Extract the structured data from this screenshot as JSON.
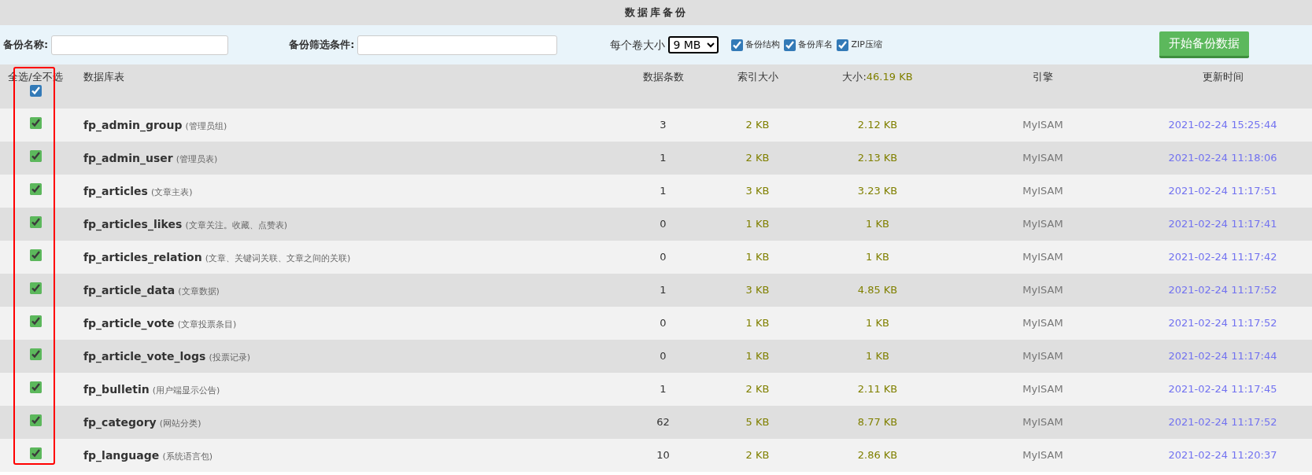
{
  "title": "数据库备份",
  "toolbar": {
    "name_label": "备份名称:",
    "filter_label": "备份筛选条件:",
    "volume_label": "每个卷大小",
    "volume_value": "9 MB",
    "options": [
      {
        "label": "备份结构",
        "checked": true
      },
      {
        "label": "备份库名",
        "checked": true
      },
      {
        "label": "ZIP压缩",
        "checked": true
      }
    ],
    "start_button": "开始备份数据"
  },
  "table": {
    "select_all": {
      "label": "全选/全不选",
      "checked": true
    },
    "columns": {
      "table": "数据库表",
      "rows": "数据条数",
      "index": "索引大小",
      "size_label": "大小:",
      "size_total": "46.19 KB",
      "engine": "引擎",
      "updated": "更新时间"
    },
    "rows": [
      {
        "checked": true,
        "name": "fp_admin_group",
        "comment": "(管理员组)",
        "rows": "3",
        "index": "2 KB",
        "size": "2.12 KB",
        "engine": "MyISAM",
        "updated": "2021-02-24 15:25:44"
      },
      {
        "checked": true,
        "name": "fp_admin_user",
        "comment": "(管理员表)",
        "rows": "1",
        "index": "2 KB",
        "size": "2.13 KB",
        "engine": "MyISAM",
        "updated": "2021-02-24 11:18:06"
      },
      {
        "checked": true,
        "name": "fp_articles",
        "comment": "(文章主表)",
        "rows": "1",
        "index": "3 KB",
        "size": "3.23 KB",
        "engine": "MyISAM",
        "updated": "2021-02-24 11:17:51"
      },
      {
        "checked": true,
        "name": "fp_articles_likes",
        "comment": "(文章关注。收藏、点赞表)",
        "rows": "0",
        "index": "1 KB",
        "size": "1 KB",
        "engine": "MyISAM",
        "updated": "2021-02-24 11:17:41"
      },
      {
        "checked": true,
        "name": "fp_articles_relation",
        "comment": "(文章、关键词关联、文章之间的关联)",
        "rows": "0",
        "index": "1 KB",
        "size": "1 KB",
        "engine": "MyISAM",
        "updated": "2021-02-24 11:17:42"
      },
      {
        "checked": true,
        "name": "fp_article_data",
        "comment": "(文章数据)",
        "rows": "1",
        "index": "3 KB",
        "size": "4.85 KB",
        "engine": "MyISAM",
        "updated": "2021-02-24 11:17:52"
      },
      {
        "checked": true,
        "name": "fp_article_vote",
        "comment": "(文章投票条目)",
        "rows": "0",
        "index": "1 KB",
        "size": "1 KB",
        "engine": "MyISAM",
        "updated": "2021-02-24 11:17:52"
      },
      {
        "checked": true,
        "name": "fp_article_vote_logs",
        "comment": "(投票记录)",
        "rows": "0",
        "index": "1 KB",
        "size": "1 KB",
        "engine": "MyISAM",
        "updated": "2021-02-24 11:17:44"
      },
      {
        "checked": true,
        "name": "fp_bulletin",
        "comment": "(用户端显示公告)",
        "rows": "1",
        "index": "2 KB",
        "size": "2.11 KB",
        "engine": "MyISAM",
        "updated": "2021-02-24 11:17:45"
      },
      {
        "checked": true,
        "name": "fp_category",
        "comment": "(网站分类)",
        "rows": "62",
        "index": "5 KB",
        "size": "8.77 KB",
        "engine": "MyISAM",
        "updated": "2021-02-24 11:17:52"
      },
      {
        "checked": true,
        "name": "fp_language",
        "comment": "(系统语言包)",
        "rows": "10",
        "index": "2 KB",
        "size": "2.86 KB",
        "engine": "MyISAM",
        "updated": "2021-02-24 11:20:37"
      }
    ]
  }
}
